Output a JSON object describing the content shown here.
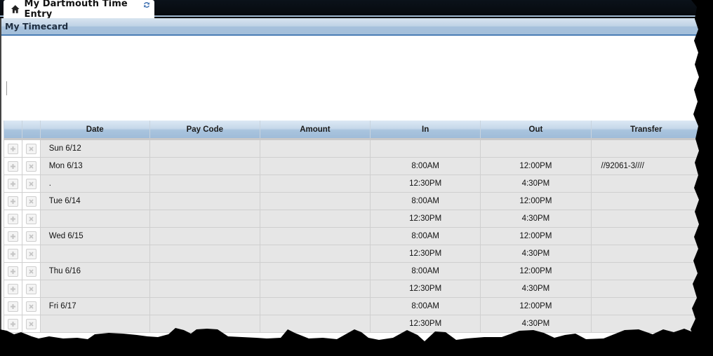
{
  "tab": {
    "title": "My Dartmouth Time Entry",
    "icon": "home-icon",
    "refresh_icon": "refresh-icon"
  },
  "panel": {
    "title": "My Timecard"
  },
  "grid": {
    "columns": [
      "",
      "",
      "Date",
      "Pay Code",
      "Amount",
      "In",
      "Out",
      "Transfer"
    ],
    "rows": [
      {
        "date": "Sun 6/12",
        "pay_code": "",
        "amount": "",
        "in": "",
        "out": "",
        "transfer": ""
      },
      {
        "date": "Mon 6/13",
        "pay_code": "",
        "amount": "",
        "in": "8:00AM",
        "out": "12:00PM",
        "transfer": "//92061-3////"
      },
      {
        "date": ".",
        "pay_code": "",
        "amount": "",
        "in": "12:30PM",
        "out": "4:30PM",
        "transfer": ""
      },
      {
        "date": "Tue 6/14",
        "pay_code": "",
        "amount": "",
        "in": "8:00AM",
        "out": "12:00PM",
        "transfer": ""
      },
      {
        "date": "",
        "pay_code": "",
        "amount": "",
        "in": "12:30PM",
        "out": "4:30PM",
        "transfer": ""
      },
      {
        "date": "Wed 6/15",
        "pay_code": "",
        "amount": "",
        "in": "8:00AM",
        "out": "12:00PM",
        "transfer": ""
      },
      {
        "date": "",
        "pay_code": "",
        "amount": "",
        "in": "12:30PM",
        "out": "4:30PM",
        "transfer": ""
      },
      {
        "date": "Thu 6/16",
        "pay_code": "",
        "amount": "",
        "in": "8:00AM",
        "out": "12:00PM",
        "transfer": ""
      },
      {
        "date": "",
        "pay_code": "",
        "amount": "",
        "in": "12:30PM",
        "out": "4:30PM",
        "transfer": ""
      },
      {
        "date": "Fri 6/17",
        "pay_code": "",
        "amount": "",
        "in": "8:00AM",
        "out": "12:00PM",
        "transfer": ""
      },
      {
        "date": "",
        "pay_code": "",
        "amount": "",
        "in": "12:30PM",
        "out": "4:30PM",
        "transfer": ""
      }
    ],
    "row_actions": {
      "add_icon": "plus-icon",
      "delete_icon": "x-icon"
    }
  }
}
